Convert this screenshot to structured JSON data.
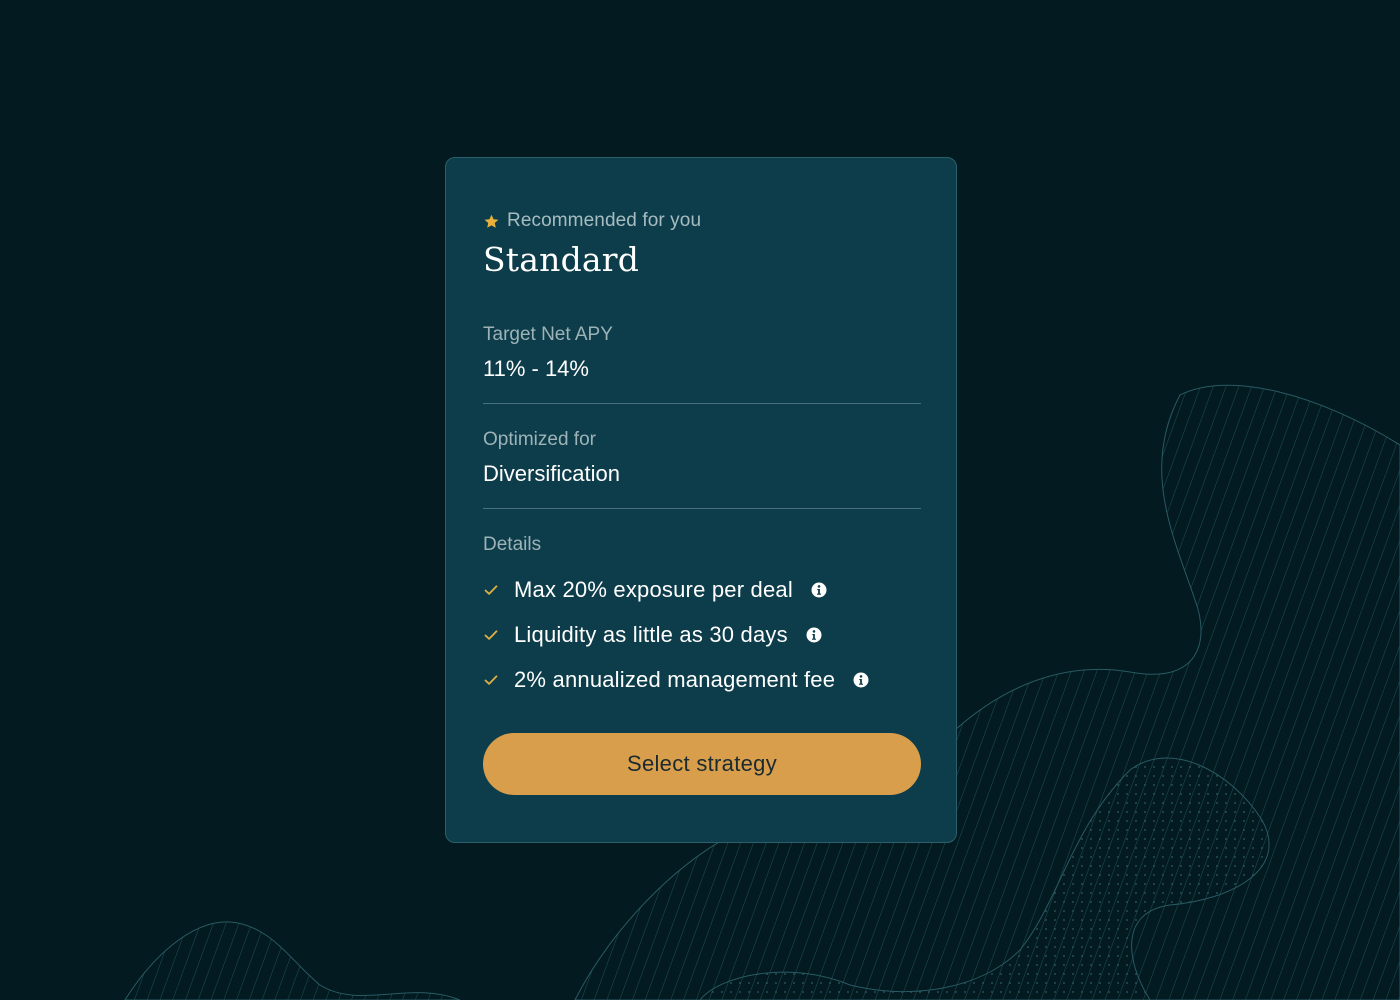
{
  "colors": {
    "background": "#021a20",
    "card": "#0d3d4a",
    "accent": "#d89e4c",
    "star": "#e8b13c",
    "check": "#e0b043"
  },
  "card": {
    "recommended_icon": "star-icon",
    "recommended_label": "Recommended for you",
    "title": "Standard",
    "apy": {
      "label": "Target Net APY",
      "value": "11% - 14%"
    },
    "optimized": {
      "label": "Optimized for",
      "value": "Diversification"
    },
    "details": {
      "label": "Details",
      "items": [
        {
          "text": "Max 20% exposure per deal",
          "icon": "check-icon",
          "info_icon": "info-icon"
        },
        {
          "text": "Liquidity as little as 30 days",
          "icon": "check-icon",
          "info_icon": "info-icon"
        },
        {
          "text": "2% annualized management fee",
          "icon": "check-icon",
          "info_icon": "info-icon"
        }
      ]
    },
    "cta_label": "Select strategy"
  }
}
